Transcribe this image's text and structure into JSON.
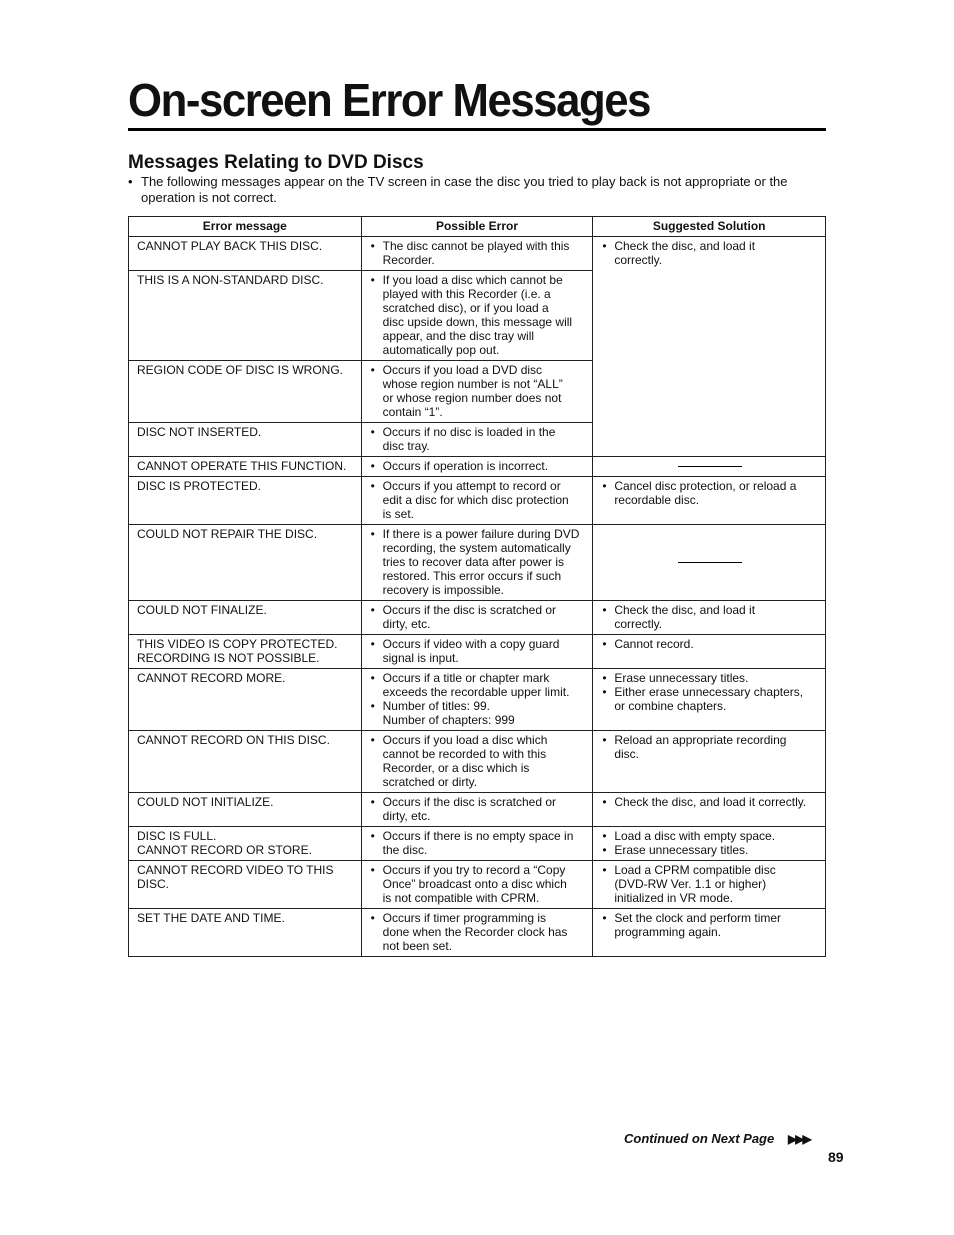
{
  "page": {
    "title": "On-screen Error Messages",
    "section_title": "Messages Relating to DVD Discs",
    "intro": "The following messages appear on the TV screen in case the disc you tried to play back is not appropriate or the operation is not correct.",
    "continued": "Continued on Next Page",
    "continued_icon": "▶▶▶",
    "page_number": "89"
  },
  "table": {
    "headers": [
      "Error message",
      "Possible Error",
      "Suggested Solution"
    ],
    "rows": [
      {
        "message": "CANNOT PLAY BACK THIS DISC.",
        "errors": [
          "The disc cannot be played with this\nRecorder."
        ],
        "solutions": [
          "Check the disc, and load it\ncorrectly."
        ],
        "solution_rowspan": 4
      },
      {
        "message": "THIS IS A NON-STANDARD DISC.",
        "errors": [
          "If you load a disc which cannot be\nplayed with this Recorder (i.e. a\nscratched disc), or if you load a\ndisc upside down, this message will\nappear, and the disc tray will\nautomatically pop out."
        ]
      },
      {
        "message": "REGION CODE OF DISC IS WRONG.",
        "errors": [
          "Occurs if you load a DVD disc\nwhose region number is not “ALL”\nor whose region number does not\ncontain “1”."
        ]
      },
      {
        "message": "DISC NOT INSERTED.",
        "errors": [
          "Occurs if no disc is loaded in the\ndisc tray."
        ]
      },
      {
        "message": "CANNOT OPERATE THIS FUNCTION.",
        "errors": [
          "Occurs if operation is incorrect."
        ],
        "solutions": []
      },
      {
        "message": "DISC IS PROTECTED.",
        "errors": [
          "Occurs if you attempt to record or\nedit a disc for which disc protection\nis set."
        ],
        "solutions": [
          "Cancel disc protection, or reload a\nrecordable disc."
        ]
      },
      {
        "message": "COULD NOT REPAIR THE DISC.",
        "errors": [
          "If there is a power failure during DVD\nrecording, the system automatically\ntries to recover data after power is\nrestored. This error occurs if such\nrecovery is impossible."
        ],
        "solutions": []
      },
      {
        "message": "COULD NOT FINALIZE.",
        "errors": [
          "Occurs if the disc is scratched or\ndirty, etc."
        ],
        "solutions": [
          "Check the disc, and load it\ncorrectly."
        ]
      },
      {
        "message": "THIS VIDEO IS COPY PROTECTED.\nRECORDING IS NOT POSSIBLE.",
        "errors": [
          "Occurs if video with a copy guard\nsignal is input."
        ],
        "solutions": [
          "Cannot record."
        ]
      },
      {
        "message": "CANNOT RECORD MORE.",
        "errors": [
          "Occurs if a title or chapter mark\nexceeds the recordable upper limit.",
          "Number of titles: 99.\nNumber of chapters: 999"
        ],
        "solutions": [
          "Erase unnecessary titles.",
          "Either erase unnecessary chapters,\nor combine chapters."
        ]
      },
      {
        "message": "CANNOT RECORD ON THIS DISC.",
        "errors": [
          "Occurs if you load a disc which\ncannot be recorded to with this\nRecorder, or a disc which is\nscratched or dirty."
        ],
        "solutions": [
          "Reload an appropriate recording\ndisc."
        ]
      },
      {
        "message": "COULD NOT INITIALIZE.",
        "errors": [
          "Occurs if the disc is scratched or\ndirty, etc."
        ],
        "solutions": [
          "Check the disc, and load it correctly."
        ]
      },
      {
        "message": "DISC IS FULL.\nCANNOT RECORD OR STORE.",
        "errors": [
          "Occurs if there is no empty space in\nthe disc."
        ],
        "solutions": [
          "Load a disc with empty space.",
          "Erase unnecessary titles."
        ]
      },
      {
        "message": "CANNOT RECORD VIDEO TO THIS\nDISC.",
        "errors": [
          "Occurs if you try to record a “Copy\nOnce” broadcast onto a disc which\nis not compatible with CPRM."
        ],
        "solutions": [
          "Load a CPRM compatible disc\n(DVD-RW Ver. 1.1 or higher)\ninitialized in VR mode."
        ]
      },
      {
        "message": "SET THE DATE AND TIME.",
        "errors": [
          "Occurs if timer programming is\ndone when the Recorder clock has\nnot been set."
        ],
        "solutions": [
          "Set the clock and perform timer\nprogramming again."
        ]
      }
    ]
  }
}
